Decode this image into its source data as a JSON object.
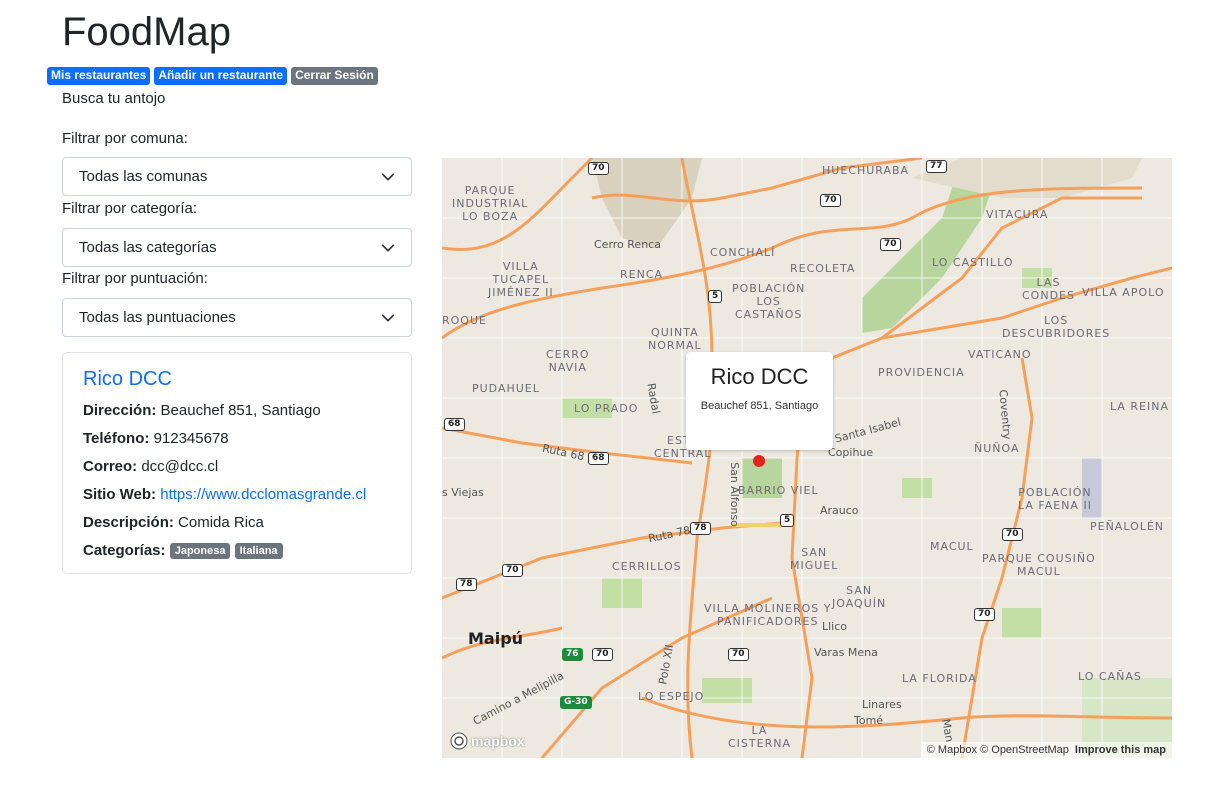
{
  "app": {
    "title": "FoodMap",
    "nav": [
      {
        "label": "Mis restaurantes",
        "style": "primary"
      },
      {
        "label": "Añadir un restaurante",
        "style": "primary"
      },
      {
        "label": "Cerrar Sesión",
        "style": "secondary"
      }
    ],
    "subtitle": "Busca tu antojo"
  },
  "filters": {
    "comuna": {
      "label": "Filtrar por comuna:",
      "selected": "Todas las comunas"
    },
    "categoria": {
      "label": "Filtrar por categoría:",
      "selected": "Todas las categorías"
    },
    "puntuacion": {
      "label": "Filtrar por puntuación:",
      "selected": "Todas las puntuaciones"
    }
  },
  "restaurant": {
    "name": "Rico DCC",
    "fields": {
      "direccion_label": "Dirección:",
      "direccion": "Beauchef 851, Santiago",
      "telefono_label": "Teléfono:",
      "telefono": "912345678",
      "correo_label": "Correo:",
      "correo": "dcc@dcc.cl",
      "sitio_label": "Sitio Web:",
      "sitio": "https://www.dcclomasgrande.cl",
      "descripcion_label": "Descripción:",
      "descripcion": "Comida Rica",
      "categorias_label": "Categorías:"
    },
    "categories": [
      "Japonesa",
      "Italiana"
    ]
  },
  "map": {
    "popup": {
      "title": "Rico DCC",
      "address": "Beauchef 851, Santiago"
    },
    "marker_color": "#e0241b",
    "labels": {
      "huechuraba": "HUECHURABA",
      "vitacura": "VITACURA",
      "parque_industrial": "PARQUE\nINDUSTRIAL\nLO BOZA",
      "cerro_renca": "Cerro Renca",
      "conchali": "CONCHALÍ",
      "recoleta": "RECOLETA",
      "lo_castillo": "LO CASTILLO",
      "villa_tucapel": "VILLA\nTUCAPEL\nJIMÉNEZ II",
      "renca": "RENCA",
      "poblacion_castanos": "POBLACIÓN\nLOS\nCASTAÑOS",
      "las_condes": "LAS\nCONDES",
      "villa_apolo": "VILLA APOLO",
      "roque": "ROQUE",
      "quinta_normal": "QUINTA\nNORMAL",
      "descubridores": "LOS\nDESCUBRIDORES",
      "cerro_navia": "CERRO\nNAVIA",
      "vaticano": "VATICANO",
      "pudahuel": "PUDAHUEL",
      "providencia": "PROVIDENCIA",
      "lo_prado": "LO PRADO",
      "la_reina": "LA REINA",
      "radal": "Radal",
      "coventry": "Coventry",
      "ruta68": "Ruta 68",
      "nunoa": "ÑUÑOA",
      "estacion_central": "ESTA\nCENTRAL",
      "copihue": "Copihue",
      "santa_isabel": "Santa Isabel",
      "las_viejas": "s Viejas",
      "barrio_viel": "BARRIO VIEL",
      "san_alfonso": "San Alfonso",
      "poblacion_faena": "POBLACIÓN\nLA FAENA II",
      "ruta78": "Ruta 78",
      "arauco": "Arauco",
      "penalolen": "PEÑALOLÉN",
      "macul": "MACUL",
      "san_miguel": "SAN\nMIGUEL",
      "parque_cousino": "PARQUE COUSIÑO\nMACUL",
      "cerrillos": "CERRILLOS",
      "san_joaquin": "SAN\nJOAQUÍN",
      "villa_molineros": "VILLA MOLINEROS Y\nPANIFICADORES",
      "llico": "Llico",
      "maipu": "Maipú",
      "varas_mena": "Varas Mena",
      "lo_canas": "LO CAÑAS",
      "camino_melipilla": "Camino a Melipilla",
      "lo_espejo": "LO ESPEJO",
      "la_florida": "LA FLORIDA",
      "linares": "Linares",
      "tome": "Tomé",
      "la_cisterna": "LA\nCISTERNA",
      "polo_xii": "Polo XII",
      "man": "Man"
    },
    "shields": [
      "70",
      "77",
      "70",
      "70",
      "5",
      "68",
      "68",
      "5",
      "78",
      "70",
      "70",
      "78",
      "70",
      "70",
      "76",
      "70",
      "5",
      "G-30"
    ],
    "logo": "mapbox",
    "attribution": "© Mapbox © OpenStreetMap",
    "improve": "Improve this map"
  }
}
